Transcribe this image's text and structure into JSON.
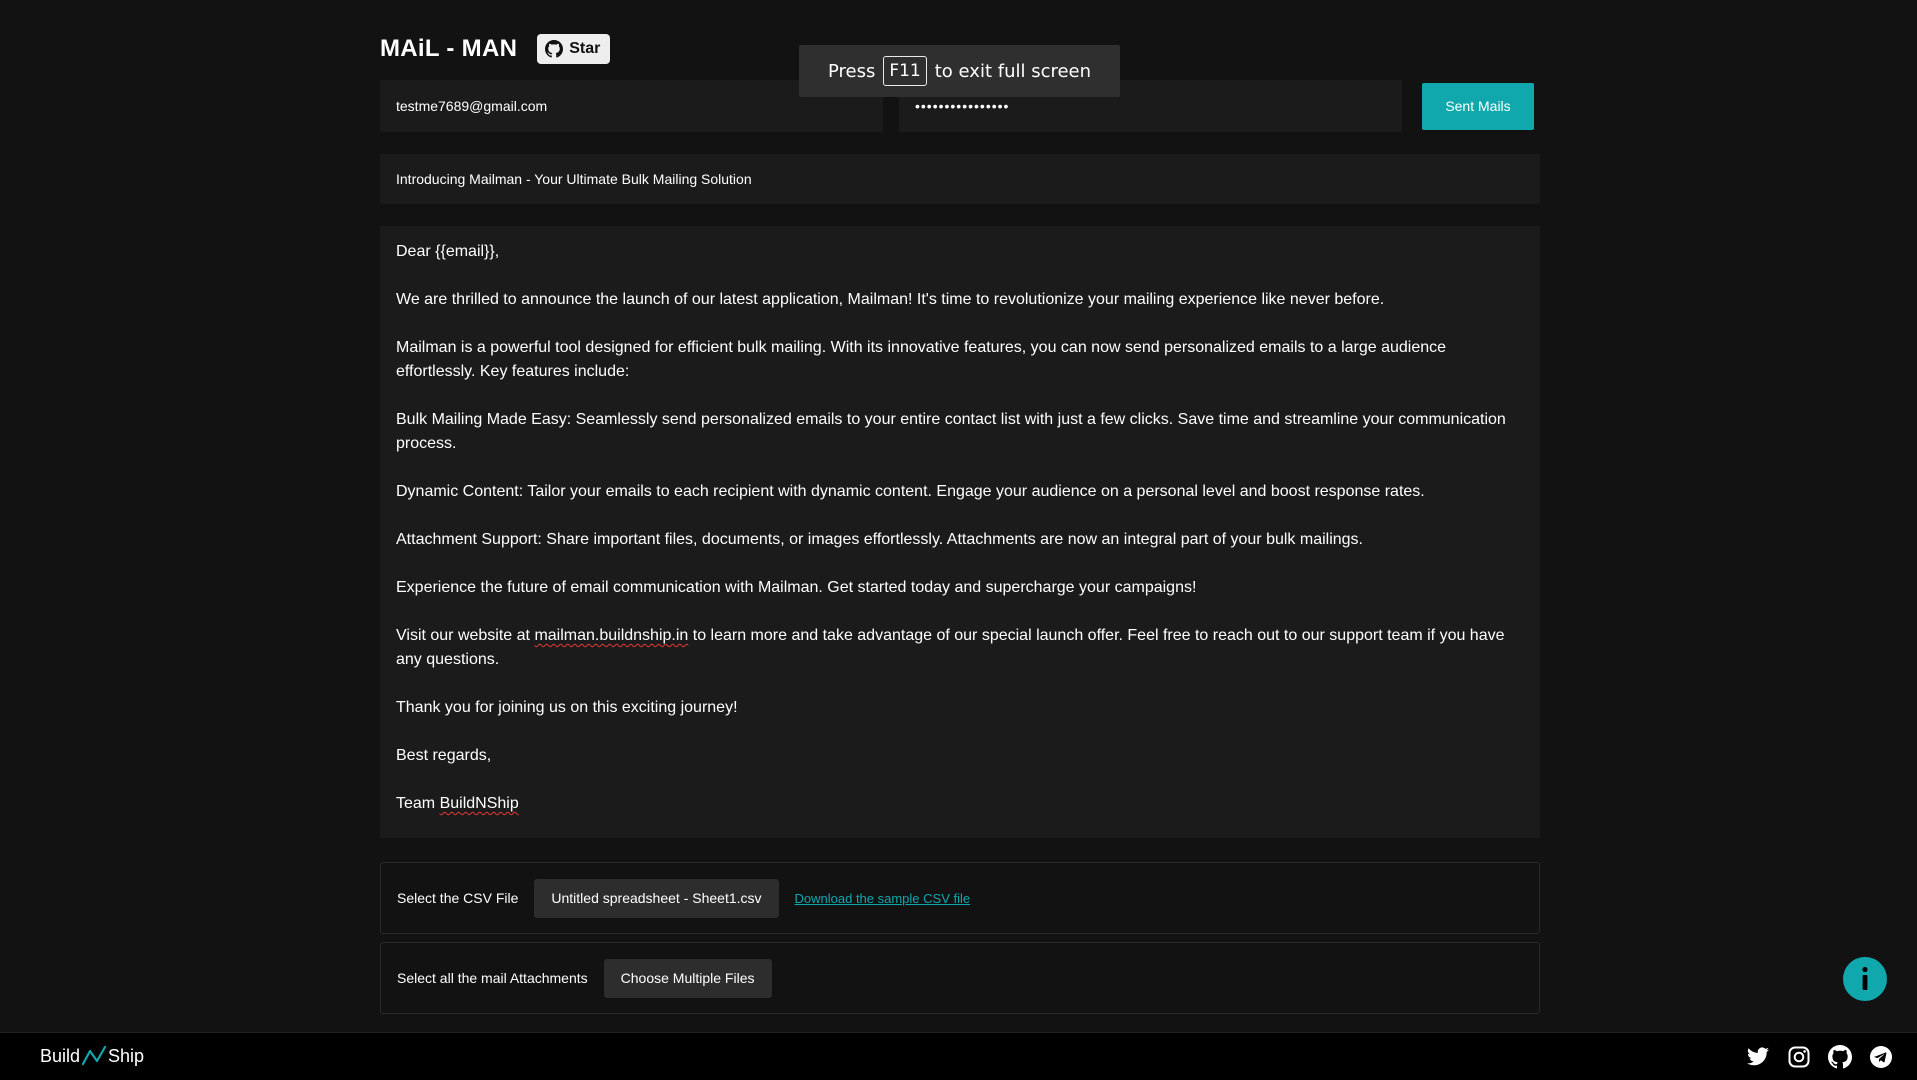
{
  "header": {
    "title": "MAiL - MAN",
    "star_label": "Star"
  },
  "credentials": {
    "email_value": "testme7689@gmail.com",
    "password_value": "••••••••••••••••",
    "send_label": "Sent Mails"
  },
  "subject": "Introducing Mailman - Your Ultimate Bulk Mailing Solution",
  "body": {
    "greeting": "Dear {{email}},",
    "p1": "We are thrilled to announce the launch of our latest application, Mailman! It's time to revolutionize your mailing experience like never before.",
    "p2": "Mailman is a powerful tool designed for efficient bulk mailing. With its innovative features, you can now send personalized emails to a large audience effortlessly. Key features include:",
    "p3": "Bulk Mailing Made Easy: Seamlessly send personalized emails to your entire contact list with just a few clicks. Save time and streamline your communication process.",
    "p4": "Dynamic Content: Tailor your emails to each recipient with dynamic content. Engage your audience on a personal level and boost response rates.",
    "p5": "Attachment Support: Share important files, documents, or images effortlessly. Attachments are now an integral part of your bulk mailings.",
    "p6": "Experience the future of email communication with Mailman. Get started today and supercharge your campaigns!",
    "p7_before": "Visit our website at ",
    "p7_link": "mailman.buildnship.in",
    "p7_after": " to learn more and take advantage of our special launch offer. Feel free to reach out to our support team if you have any questions.",
    "p8": "Thank you for joining us on this exciting journey!",
    "p9": "Best regards,",
    "sign_prefix": "Team ",
    "sign_name": "BuildNShip"
  },
  "csv": {
    "label": "Select the CSV File",
    "button_label": "Untitled spreadsheet - Sheet1.csv",
    "sample_link": "Download the sample CSV file"
  },
  "attachments": {
    "label": "Select all the mail Attachments",
    "button_label": "Choose Multiple Files"
  },
  "toast": {
    "prefix": "Press",
    "key": "F11",
    "suffix": "to exit full screen"
  },
  "footer": {
    "brand_left": "Build",
    "brand_right": "Ship",
    "icons": [
      "twitter-icon",
      "instagram-icon",
      "github-icon",
      "telegram-icon"
    ]
  },
  "colors": {
    "accent": "#10a7ad",
    "background": "#121212",
    "panel": "#1b1b1b"
  }
}
